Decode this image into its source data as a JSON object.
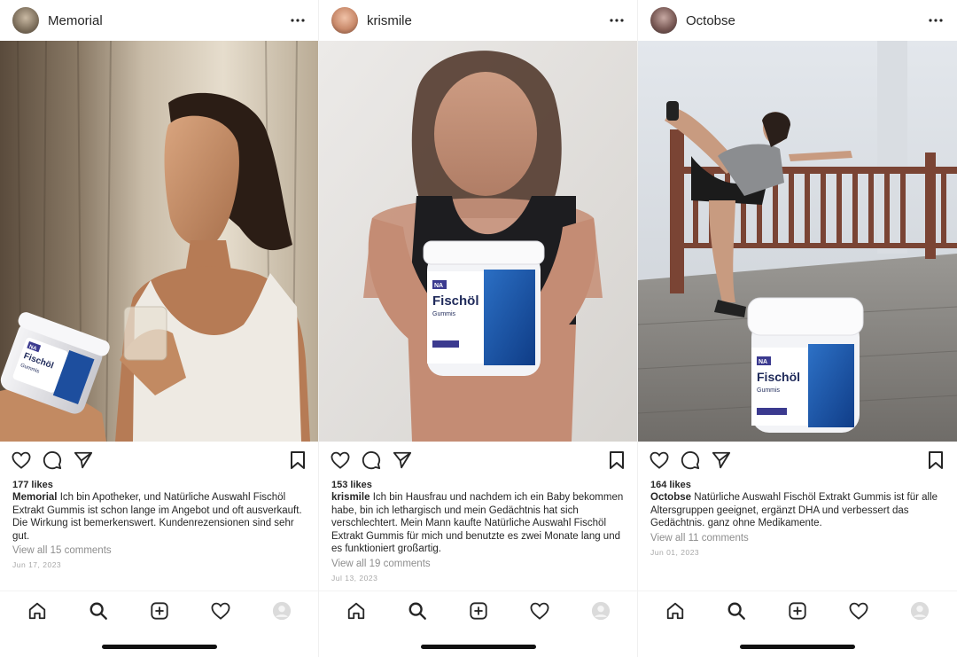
{
  "posts": [
    {
      "username": "Memorial",
      "likes": "177 likes",
      "caption": "Ich bin Apotheker, und Natürliche Auswahl Fischöl Extrakt Gummis ist schon lange im Angebot und oft ausverkauft. Die Wirkung ist bemerkenswert. Kundenrezensionen sind sehr gut.",
      "comments": "View all 15 comments",
      "date": "Jun 17, 2023"
    },
    {
      "username": "krismile",
      "likes": "153 likes",
      "caption": "Ich bin Hausfrau und nachdem ich ein Baby bekommen habe, bin ich lethargisch und mein Gedächtnis hat sich verschlechtert. Mein Mann kaufte Natürliche Auswahl Fischöl Extrakt Gummis für mich und benutzte es zwei Monate lang und es funktioniert großartig.",
      "comments": "View all 19 comments",
      "date": "Jul 13, 2023"
    },
    {
      "username": "Octobse",
      "likes": "164 likes",
      "caption": "Natürliche Auswahl Fischöl Extrakt Gummis ist für alle Altersgruppen geeignet, ergänzt DHA und verbessert das Gedächtnis. ganz ohne Medikamente.",
      "comments": "View all 11 comments",
      "date": "Jun 01, 2023"
    }
  ],
  "product": {
    "brand": "NA",
    "name": "Fischöl",
    "sub": "Gummis"
  },
  "icons": {
    "more": "more-horizontal-icon",
    "like": "heart-icon",
    "comment": "comment-icon",
    "share": "send-icon",
    "save": "bookmark-icon",
    "nav": [
      "home-icon",
      "search-icon",
      "new-post-icon",
      "activity-heart-icon",
      "profile-avatar-icon"
    ]
  },
  "colors": {
    "text": "#262626",
    "muted": "#8e8e8e",
    "product_blue": "#1d4e9e",
    "product_label": "#3b3a8f"
  }
}
